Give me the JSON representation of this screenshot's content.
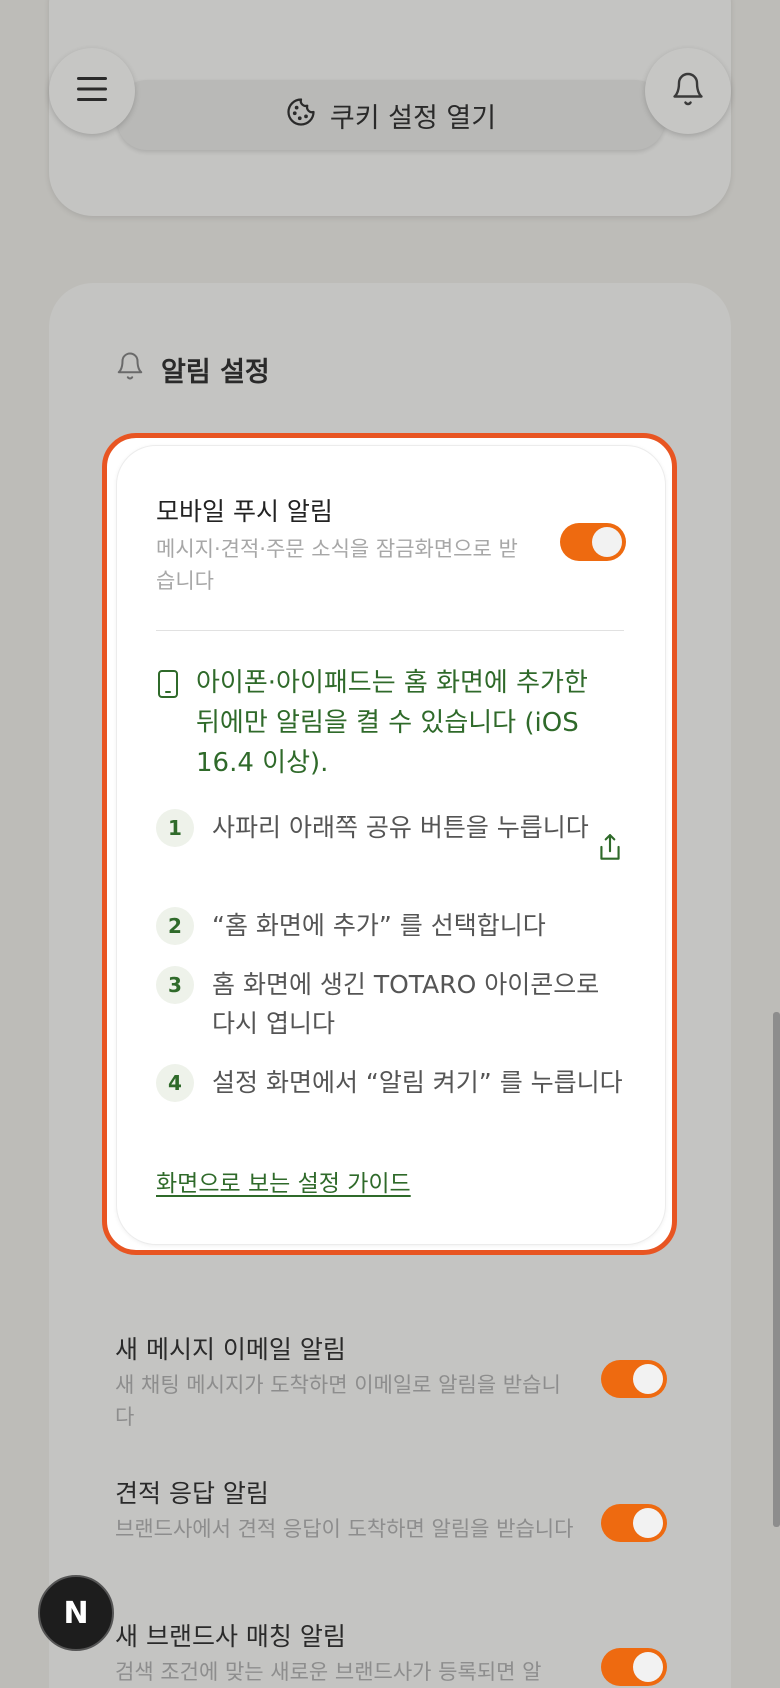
{
  "header": {
    "cookie_button_label": "쿠키 설정 열기",
    "menu_icon": "hamburger-menu-icon",
    "bell_icon": "bell-icon"
  },
  "notification_settings": {
    "title": "알림 설정",
    "push": {
      "title": "모바일 푸시 알림",
      "description": "메시지·견적·주문 소식을 잠금화면으로 받습니다",
      "enabled": true
    },
    "ios_note": "아이폰·아이패드는 홈 화면에 추가한 뒤에만 알림을 켤 수 있습니다 (iOS 16.4 이상).",
    "steps": [
      {
        "number": "1",
        "text": "사파리 아래쪽 공유 버튼을 누릅니다"
      },
      {
        "number": "2",
        "text": "“홈 화면에 추가” 를 선택합니다"
      },
      {
        "number": "3",
        "text": "홈 화면에 생긴 TOTARO 아이콘으로 다시 엽니다"
      },
      {
        "number": "4",
        "text": "설정 화면에서 “알림 켜기” 를 누릅니다"
      }
    ],
    "guide_link": "화면으로 보는 설정 가이드",
    "rows": [
      {
        "title": "새 메시지 이메일 알림",
        "description": "새 채팅 메시지가 도착하면 이메일로 알림을 받습니다",
        "enabled": true
      },
      {
        "title": "견적 응답 알림",
        "description": "브랜드사에서 견적 응답이 도착하면 알림을 받습니다",
        "enabled": true
      },
      {
        "title": "새 브랜드사 매칭 알림",
        "description": "검색 조건에 맞는 새로운 브랜드사가 등록되면 알",
        "enabled": true
      }
    ]
  },
  "dev_badge": "N",
  "colors": {
    "accent": "#ee6a10",
    "highlight_border": "#e85522",
    "green_text": "#2f6a2a"
  }
}
